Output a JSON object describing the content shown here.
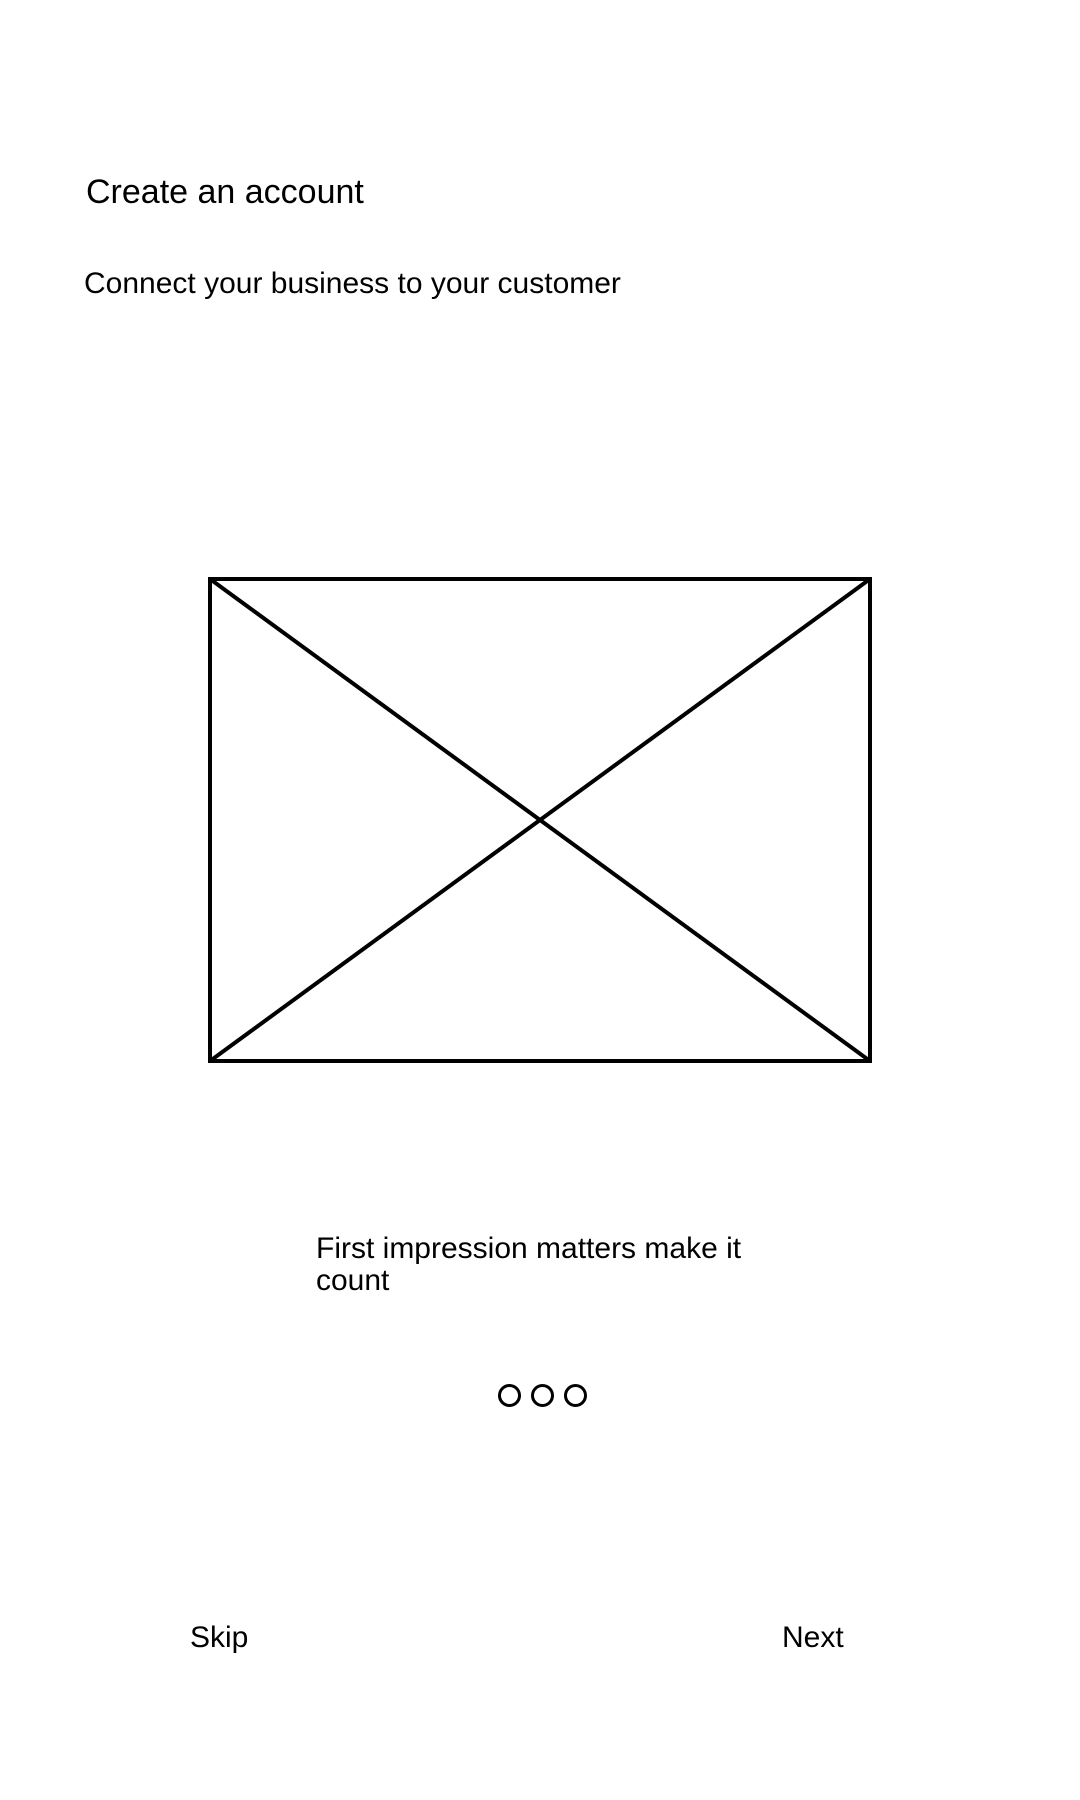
{
  "header": {
    "title": "Create an account",
    "subtitle": "Connect your business to your customer"
  },
  "onboarding": {
    "image_icon": "image-placeholder-icon",
    "caption": "First impression matters make it count",
    "pagination": {
      "total": 3
    }
  },
  "footer": {
    "skip_label": "Skip",
    "next_label": "Next"
  },
  "colors": {
    "background": "#ffffff",
    "foreground": "#000000"
  }
}
